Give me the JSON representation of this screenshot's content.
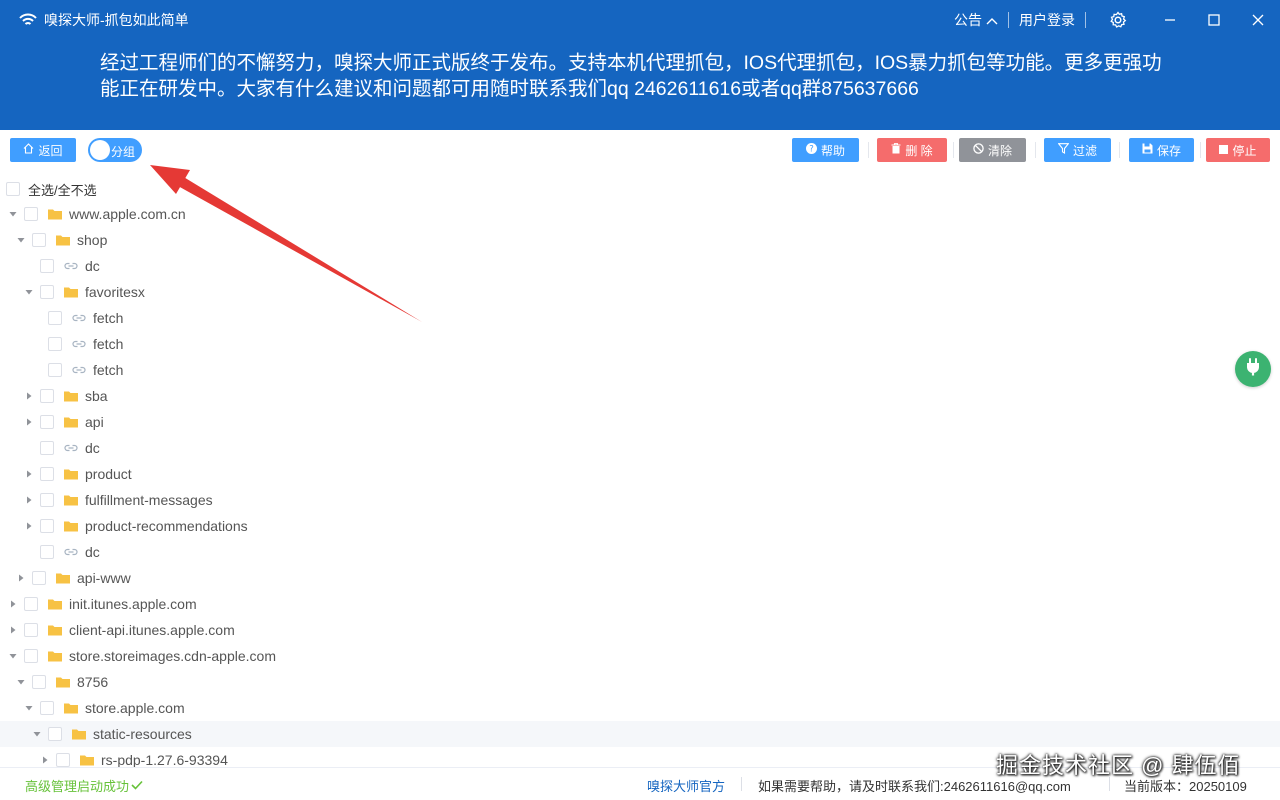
{
  "app": {
    "title": "嗅探大师-抓包如此简单",
    "announcement_label": "公告",
    "login_label": "用户登录"
  },
  "banner": {
    "text": "经过工程师们的不懈努力，嗅探大师正式版终于发布。支持本机代理抓包，IOS代理抓包，IOS暴力抓包等功能。更多更强功能正在研发中。大家有什么建议和问题都可用随时联系我们qq 2462611616或者qq群875637666"
  },
  "toolbar": {
    "back_label": "返回",
    "group_label": "分组",
    "help_label": "帮助",
    "delete_label": "删 除",
    "clear_label": "清除",
    "filter_label": "过滤",
    "save_label": "保存",
    "stop_label": "停止"
  },
  "tree": {
    "select_all_label": "全选/全不选",
    "nodes": [
      {
        "label": "www.apple.com.cn",
        "level": 0,
        "type": "folder",
        "state": "open"
      },
      {
        "label": "shop",
        "level": 1,
        "type": "folder",
        "state": "open"
      },
      {
        "label": "dc",
        "level": 2,
        "type": "link",
        "state": "leaf"
      },
      {
        "label": "favoritesx",
        "level": 2,
        "type": "folder",
        "state": "open"
      },
      {
        "label": "fetch",
        "level": 3,
        "type": "link",
        "state": "leaf"
      },
      {
        "label": "fetch",
        "level": 3,
        "type": "link",
        "state": "leaf"
      },
      {
        "label": "fetch",
        "level": 3,
        "type": "link",
        "state": "leaf"
      },
      {
        "label": "sba",
        "level": 2,
        "type": "folder",
        "state": "closed"
      },
      {
        "label": "api",
        "level": 2,
        "type": "folder",
        "state": "closed"
      },
      {
        "label": "dc",
        "level": 2,
        "type": "link",
        "state": "leaf"
      },
      {
        "label": "product",
        "level": 2,
        "type": "folder",
        "state": "closed"
      },
      {
        "label": "fulfillment-messages",
        "level": 2,
        "type": "folder",
        "state": "closed"
      },
      {
        "label": "product-recommendations",
        "level": 2,
        "type": "folder",
        "state": "closed"
      },
      {
        "label": "dc",
        "level": 2,
        "type": "link",
        "state": "leaf"
      },
      {
        "label": "api-www",
        "level": 1,
        "type": "folder",
        "state": "closed"
      },
      {
        "label": "init.itunes.apple.com",
        "level": 0,
        "type": "folder",
        "state": "closed"
      },
      {
        "label": "client-api.itunes.apple.com",
        "level": 0,
        "type": "folder",
        "state": "closed"
      },
      {
        "label": "store.storeimages.cdn-apple.com",
        "level": 0,
        "type": "folder",
        "state": "open"
      },
      {
        "label": "8756",
        "level": 1,
        "type": "folder",
        "state": "open"
      },
      {
        "label": "store.apple.com",
        "level": 2,
        "type": "folder",
        "state": "open"
      },
      {
        "label": "static-resources",
        "level": 3,
        "type": "folder",
        "state": "open",
        "highlight": true
      },
      {
        "label": "rs-pdp-1.27.6-93394",
        "level": 4,
        "type": "folder",
        "state": "closed"
      }
    ]
  },
  "status": {
    "left_text": "高级管理启动成功",
    "official_label": "嗅探大师官方",
    "help_text": "如果需要帮助，请及时联系我们:2462611616@qq.com",
    "version_text": "当前版本：20250109"
  },
  "watermark": "掘金技术社区 @ 肆伍佰",
  "colors": {
    "brand": "#1565c0",
    "primary_button": "#409eff",
    "danger_button": "#f56c6c",
    "neutral_button": "#909399",
    "folder": "#f7c244",
    "success": "#67c23a",
    "plugin_fab": "#3cb371",
    "annotation_arrow": "#e53935"
  }
}
